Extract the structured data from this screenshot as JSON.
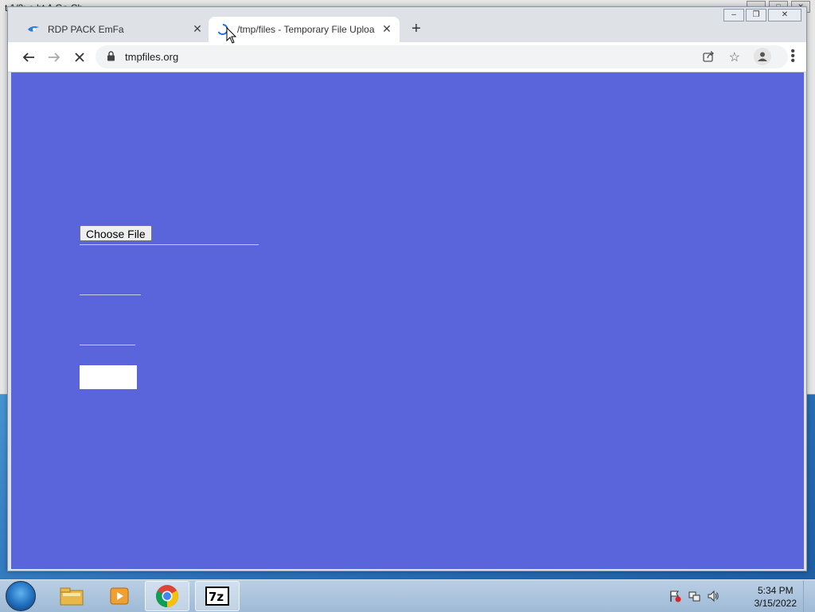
{
  "background_window": {
    "title": "t 1/2:  e ht A  Ga  Ch"
  },
  "browser": {
    "tabs": [
      {
        "label": "RDP PACK EmFa",
        "active": false
      },
      {
        "label": "/tmp/files - Temporary File Uploa",
        "active": true
      }
    ],
    "new_tab_symbol": "+",
    "address": "tmpfiles.org",
    "colors": {
      "page_background": "#5a65dc",
      "tabstrip": "#dee1e6"
    }
  },
  "page": {
    "file_input_label": "Choose File"
  },
  "taskbar": {
    "clock_time": "5:34 PM",
    "clock_date": "3/15/2022",
    "apps": [
      "file-explorer",
      "media-player",
      "chrome",
      "7-zip"
    ]
  }
}
